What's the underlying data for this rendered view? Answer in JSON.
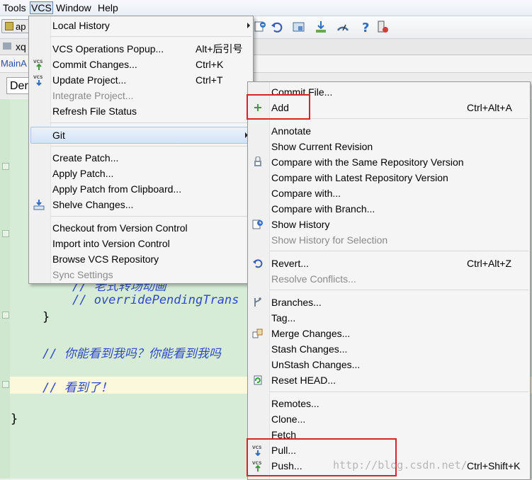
{
  "menubar": {
    "items": [
      "Tools",
      "VCS",
      "Window",
      "Help"
    ]
  },
  "toolbar": {
    "run_config": "ap",
    "icons": [
      "vcs-update-icon",
      "revert-icon",
      "folder-icon",
      "sdk-icon",
      "profiler-icon",
      "help-icon",
      "device-icon"
    ]
  },
  "tabs": {
    "first": "xq"
  },
  "nav": {
    "path": "MainA"
  },
  "class_combo": {
    "value": "Der"
  },
  "editor": {
    "lines": [
      "// 老式转场动画",
      "// overridePendingTrans",
      "}",
      "// 你能看到我吗？你能看到我吗",
      "// 看到了！",
      "}"
    ]
  },
  "vcs_menu": {
    "items": [
      {
        "label": "Local History",
        "submenu": true
      },
      {
        "label": "VCS Operations Popup...",
        "shortcut": "Alt+后引号"
      },
      {
        "label": "Commit Changes...",
        "shortcut": "Ctrl+K",
        "icon": "vcs-commit-icon"
      },
      {
        "label": "Update Project...",
        "shortcut": "Ctrl+T",
        "icon": "vcs-update-icon"
      },
      {
        "label": "Integrate Project...",
        "disabled": true
      },
      {
        "label": "Refresh File Status"
      },
      {
        "label": "Git",
        "submenu": true,
        "highlighted": true
      },
      {
        "label": "Create Patch..."
      },
      {
        "label": "Apply Patch..."
      },
      {
        "label": "Apply Patch from Clipboard..."
      },
      {
        "label": "Shelve Changes...",
        "icon": "shelve-icon"
      },
      {
        "label": "Checkout from Version Control",
        "submenu": true
      },
      {
        "label": "Import into Version Control",
        "submenu": true
      },
      {
        "label": "Browse VCS Repository",
        "submenu": true
      },
      {
        "label": "Sync Settings",
        "disabled": true,
        "submenu": true
      }
    ]
  },
  "git_menu": {
    "items": [
      {
        "label": "Commit File..."
      },
      {
        "label": "Add",
        "shortcut": "Ctrl+Alt+A",
        "icon": "plus-icon"
      },
      {
        "label": "Annotate"
      },
      {
        "label": "Show Current Revision"
      },
      {
        "label": "Compare with the Same Repository Version",
        "icon": "compare-icon"
      },
      {
        "label": "Compare with Latest Repository Version"
      },
      {
        "label": "Compare with..."
      },
      {
        "label": "Compare with Branch..."
      },
      {
        "label": "Show History",
        "icon": "history-icon"
      },
      {
        "label": "Show History for Selection",
        "disabled": true
      },
      {
        "label": "Revert...",
        "shortcut": "Ctrl+Alt+Z",
        "icon": "revert-icon"
      },
      {
        "label": "Resolve Conflicts...",
        "disabled": true
      },
      {
        "label": "Branches...",
        "icon": "branch-icon"
      },
      {
        "label": "Tag..."
      },
      {
        "label": "Merge Changes...",
        "icon": "merge-icon"
      },
      {
        "label": "Stash Changes..."
      },
      {
        "label": "UnStash Changes..."
      },
      {
        "label": "Reset HEAD...",
        "icon": "reset-icon"
      },
      {
        "label": "Remotes..."
      },
      {
        "label": "Clone..."
      },
      {
        "label": "Fetch"
      },
      {
        "label": "Pull...",
        "icon": "vcs-pull-icon"
      },
      {
        "label": "Push...",
        "shortcut": "Ctrl+Shift+K",
        "icon": "vcs-push-icon"
      }
    ]
  },
  "watermark": "http://blog.csdn.net/",
  "colors": {
    "highlight_box": "#d9241f",
    "code_comment": "#2f48c6",
    "editor_bg": "#d7ecd7"
  }
}
